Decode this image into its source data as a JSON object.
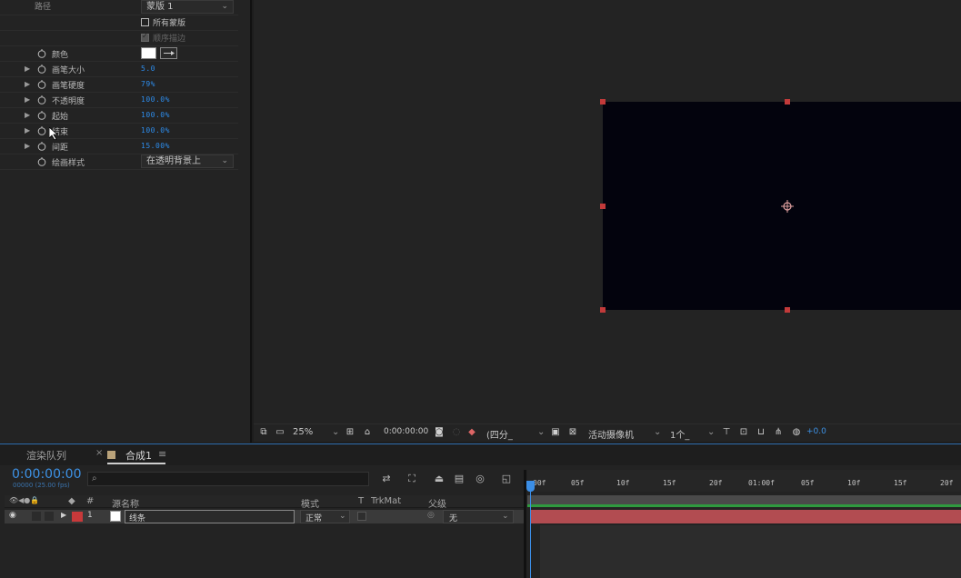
{
  "effects": {
    "path_value": "蒙版 1",
    "all_masks_label": "所有蒙版",
    "sequential_label": "顺序描边",
    "color_label": "颜色",
    "brush_size_label": "画笔大小",
    "brush_size_value": "5.0",
    "brush_hardness_label": "画笔硬度",
    "brush_hardness_value": "79%",
    "opacity_label": "不透明度",
    "opacity_value": "100.0%",
    "start_label": "起始",
    "start_value": "100.0%",
    "end_label": "结束",
    "end_value": "100.0%",
    "spacing_label": "间距",
    "spacing_value": "15.00%",
    "paint_style_label": "绘画样式",
    "paint_style_value": "在透明背景上"
  },
  "viewer_toolbar": {
    "zoom": "25%",
    "timecode": "0:00:00:00",
    "resolution": "(四分_",
    "camera": "活动摄像机",
    "views": "1个_",
    "exposure": "+0.0"
  },
  "timeline": {
    "tab_render_queue": "渲染队列",
    "tab_comp": "合成1",
    "timecode": "0:00:00:00",
    "frames": "00000 (25.00 fps)",
    "search_placeholder": "",
    "col_num": "#",
    "col_source": "源名称",
    "col_mode": "模式",
    "col_t": "T",
    "col_trkmat": "TrkMat",
    "col_parent": "父级",
    "layer_num": "1",
    "layer_name": "线条",
    "layer_mode": "正常",
    "layer_parent": "无",
    "ruler_ticks": [
      "00f",
      "05f",
      "10f",
      "15f",
      "20f",
      "01:00f",
      "05f",
      "10f",
      "15f",
      "20f"
    ]
  },
  "colors": {
    "accent_blue": "#3d92e6",
    "label_red": "#c8393a",
    "layer_bar": "#b24c51",
    "comp_bg": "#03030d"
  }
}
